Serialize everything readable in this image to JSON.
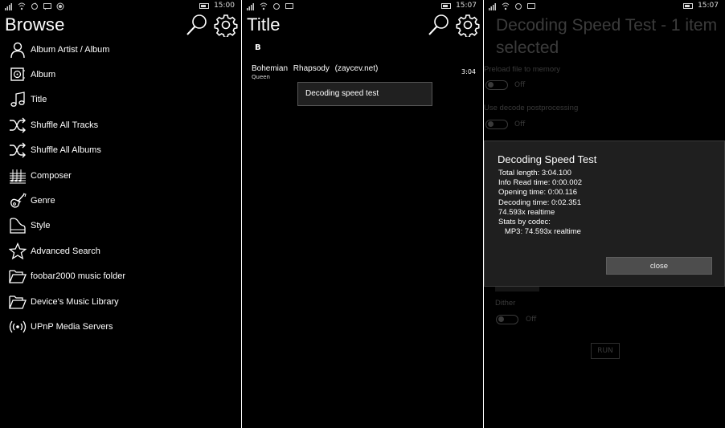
{
  "screen1": {
    "status_time": "15:00",
    "title": "Browse",
    "items": [
      {
        "label": "Album Artist / Album",
        "icon": "person-icon"
      },
      {
        "label": "Album",
        "icon": "album-icon"
      },
      {
        "label": "Title",
        "icon": "music-note-icon"
      },
      {
        "label": "Shuffle All Tracks",
        "icon": "shuffle-icon"
      },
      {
        "label": "Shuffle All Albums",
        "icon": "shuffle-icon"
      },
      {
        "label": "Composer",
        "icon": "sheet-music-icon"
      },
      {
        "label": "Genre",
        "icon": "guitar-icon"
      },
      {
        "label": "Style",
        "icon": "piano-icon"
      },
      {
        "label": "Advanced Search",
        "icon": "star-icon"
      },
      {
        "label": "foobar2000 music folder",
        "icon": "folder-icon"
      },
      {
        "label": "Device's Music Library",
        "icon": "folder-icon"
      },
      {
        "label": "UPnP Media Servers",
        "icon": "broadcast-icon"
      }
    ]
  },
  "screen2": {
    "status_time": "15:07",
    "title": "Title",
    "group_letter": "B",
    "track": {
      "title": "Bohemian Rhapsody (zaycev.net)",
      "artist": "Queen",
      "duration": "3:04"
    },
    "context_menu": {
      "item": "Decoding speed test"
    }
  },
  "screen3": {
    "status_time": "15:07",
    "title": "Decoding Speed Test - 1 item selected",
    "settings": {
      "preload_label": "Preload file to memory",
      "preload_state": "Off",
      "postproc_label": "Use decode postprocessing",
      "postproc_state": "Off",
      "dither_label": "Dither",
      "dither_state": "Off",
      "run_label": "RUN"
    },
    "dialog": {
      "title": "Decoding Speed Test",
      "lines": [
        "Total length: 3:04.100",
        "Info Read time: 0:00.002",
        "Opening time: 0:00.116",
        "Decoding time: 0:02.351",
        "74.593x realtime",
        "Stats by codec:",
        "   MP3: 74.593x realtime"
      ],
      "close_label": "close"
    }
  }
}
